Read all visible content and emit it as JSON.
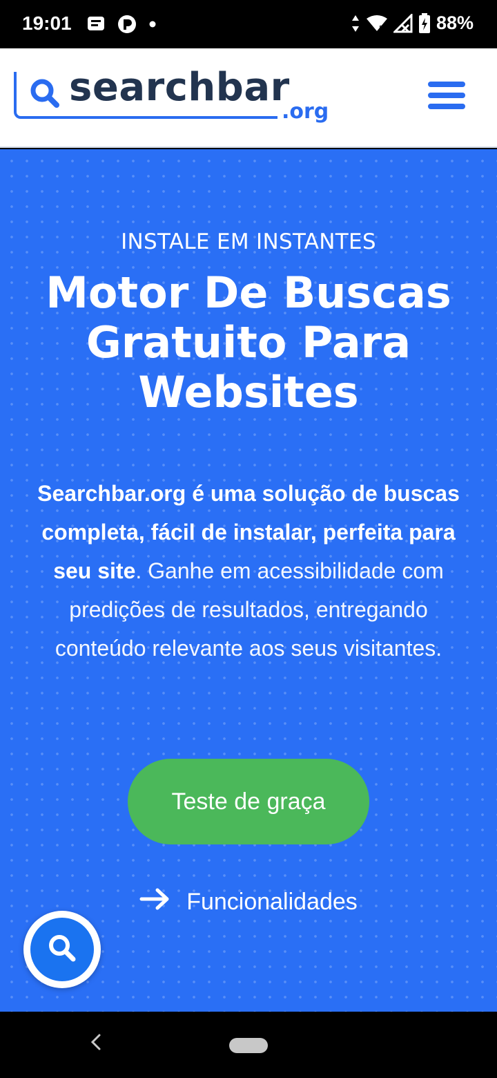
{
  "status_bar": {
    "time": "19:01",
    "battery": "88%",
    "icons": [
      "message-icon",
      "parking-icon",
      "dot-icon",
      "data-arrows-icon",
      "wifi-icon",
      "signal-icon",
      "battery-icon"
    ]
  },
  "header": {
    "logo_word": "searchbar",
    "logo_tld": ".org",
    "menu_icon": "hamburger-menu-icon",
    "colors": {
      "brand_blue": "#2a6cf0",
      "logo_text": "#22344f"
    }
  },
  "hero": {
    "eyebrow": "INSTALE EM INSTANTES",
    "title": "Motor De Buscas Gratuito Para Websites",
    "description_bold": "Searchbar.org é uma solução de buscas completa, fácil de instalar, perfeita para seu site",
    "description_rest": ". Ganhe em acessibilidade com predições de resultados, entregando conteúdo relevante aos seus visitantes.",
    "cta_label": "Teste de graça",
    "features_label": "Funcionalidades",
    "colors": {
      "background": "#2a6ff5",
      "cta": "#4bb85a"
    }
  },
  "floating": {
    "icon": "search-icon"
  },
  "nav": {
    "back_icon": "back-chevron-icon",
    "home_icon": "home-pill-icon"
  }
}
